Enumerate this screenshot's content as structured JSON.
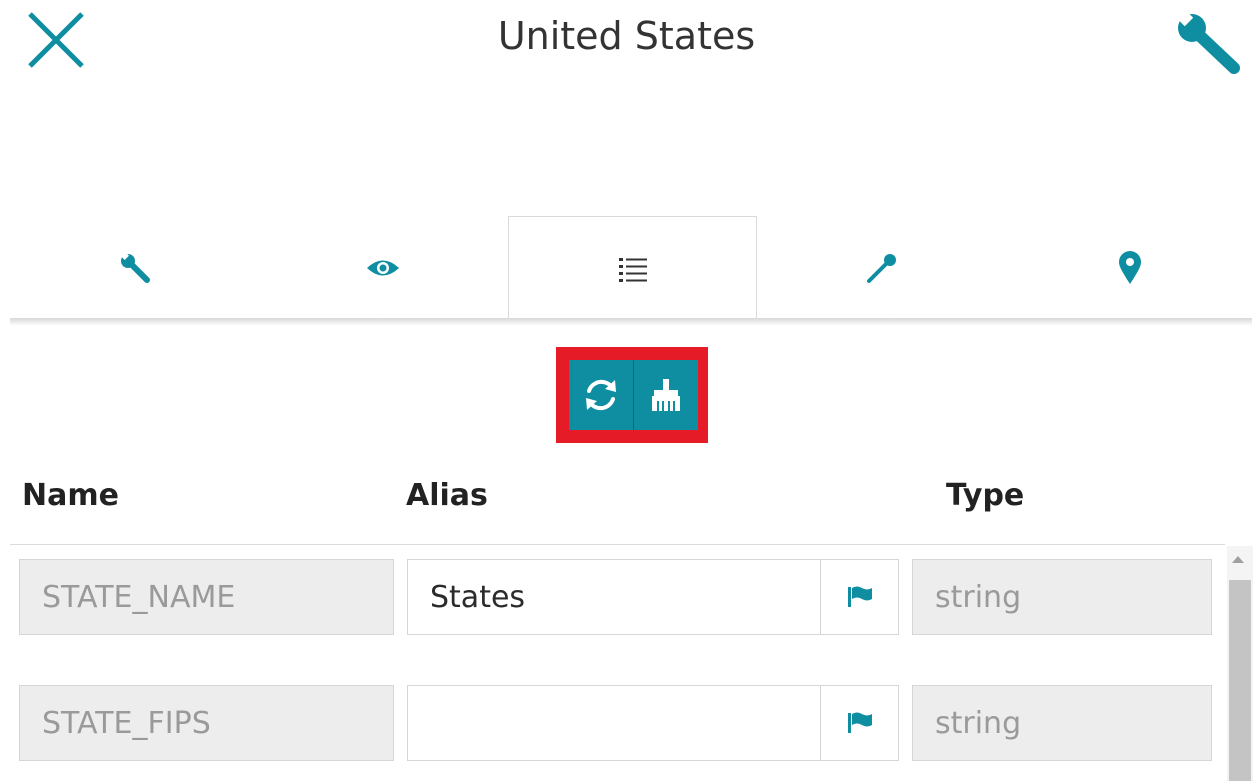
{
  "header": {
    "title": "United States",
    "close_icon": "close-icon",
    "settings_icon": "wrench-icon"
  },
  "tabs": [
    {
      "icon": "wrench-icon",
      "active": false
    },
    {
      "icon": "eye-icon",
      "active": false
    },
    {
      "icon": "list-icon",
      "active": true
    },
    {
      "icon": "eyedropper-icon",
      "active": false
    },
    {
      "icon": "map-marker-icon",
      "active": false
    }
  ],
  "toolbar": {
    "buttons": [
      "refresh-icon",
      "broom-icon"
    ],
    "highlight_color": "#e51c27"
  },
  "table": {
    "columns": [
      "Name",
      "Alias",
      "Type"
    ],
    "rows": [
      {
        "name": "STATE_NAME",
        "alias": "States",
        "type": "string"
      },
      {
        "name": "STATE_FIPS",
        "alias": "",
        "type": "string"
      }
    ]
  },
  "colors": {
    "accent": "#0f8ea1",
    "readonly_bg": "#ededed"
  }
}
